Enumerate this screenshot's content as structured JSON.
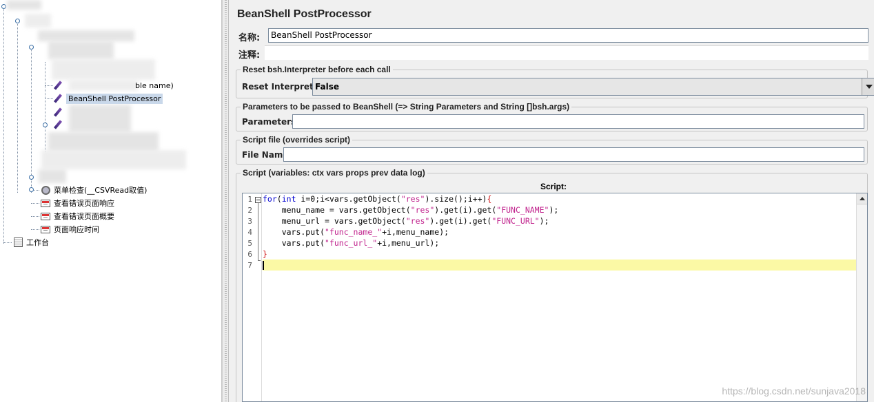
{
  "tree": {
    "partial_label": "ble name)",
    "selected_item": "BeanShell PostProcessor",
    "items": [
      {
        "label": "菜单检查(__CSVRead取值)",
        "icon": "gear-icon"
      },
      {
        "label": "查看错误页面响应",
        "icon": "listener-icon"
      },
      {
        "label": "查看错误页面概要",
        "icon": "listener-icon"
      },
      {
        "label": "页面响应时间",
        "icon": "listener-icon"
      }
    ],
    "workbench_label": "工作台"
  },
  "panel": {
    "title": "BeanShell PostProcessor",
    "name_label": "名称:",
    "name_value": "BeanShell PostProcessor",
    "comment_label": "注释:",
    "comment_value": "",
    "reset_group_title": "Reset bsh.Interpreter before each call",
    "reset_label": "Reset Interpreter:",
    "reset_value": "False",
    "params_group_title": "Parameters to be passed to BeanShell (=> String Parameters and String []bsh.args)",
    "params_label": "Parameters:",
    "params_value": "",
    "file_group_title": "Script file (overrides script)",
    "file_label": "File Name:",
    "file_value": "",
    "script_group_title": "Script (variables: ctx vars props prev data log)",
    "script_header": "Script:"
  },
  "script": {
    "line_numbers": [
      "1",
      "2",
      "3",
      "4",
      "5",
      "6",
      "7"
    ],
    "lines": [
      "for(int i=0;i<vars.getObject(\"res\").size();i++){",
      "    menu_name = vars.getObject(\"res\").get(i).get(\"FUNC_NAME\");",
      "    menu_url = vars.getObject(\"res\").get(i).get(\"FUNC_URL\");",
      "    vars.put(\"func_name_\"+i,menu_name);",
      "    vars.put(\"func_url_\"+i,menu_url);",
      "}",
      ""
    ]
  },
  "watermark": "https://blog.csdn.net/sunjava2018"
}
